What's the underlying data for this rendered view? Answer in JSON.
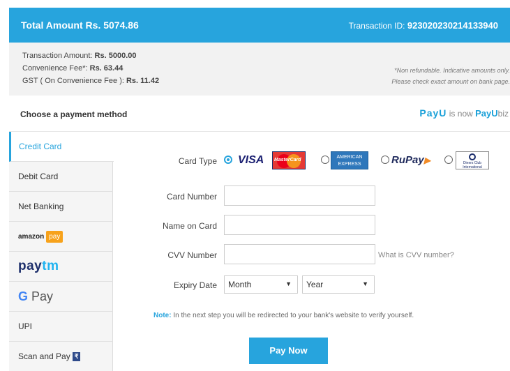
{
  "header": {
    "total_label": "Total Amount",
    "total_value": "Rs. 5074.86",
    "txn_label": "Transaction ID:",
    "txn_value": "923020230214133940"
  },
  "summary": {
    "txn_amount_label": "Transaction Amount:",
    "txn_amount": "Rs. 5000.00",
    "fee_label": "Convenience Fee*:",
    "fee": "Rs. 63.44",
    "gst_label": "GST ( On Convenience Fee ):",
    "gst": "Rs. 11.42",
    "note1": "*Non refundable. Indicative amounts only.",
    "note2": "Please check exact amount on bank page."
  },
  "choose_title": "Choose a payment method",
  "payu": {
    "brand": "PayU",
    "middle": "is now",
    "brand2": "PayU",
    "suffix": "biz"
  },
  "sidebar": {
    "credit_card": "Credit Card",
    "debit_card": "Debit Card",
    "net_banking": "Net Banking",
    "amazon": "amazon",
    "amazon_pay": "pay",
    "paytm_a": "pay",
    "paytm_b": "tm",
    "gpay_g": "G",
    "gpay_pay": "Pay",
    "upi": "UPI",
    "scan_pay": "Scan and Pay",
    "bharat": "₹"
  },
  "form": {
    "card_type_label": "Card Type",
    "visa": "VISA",
    "mastercard": "MasterCard",
    "amex_line1": "AMERICAN",
    "amex_line2": "EXPRESS",
    "rupay": "RuPay",
    "diners_line1": "Diners Club",
    "diners_line2": "International",
    "card_number_label": "Card Number",
    "card_number_value": "",
    "name_label": "Name on Card",
    "name_value": "",
    "cvv_label": "CVV Number",
    "cvv_value": "",
    "cvv_help": "What is CVV number?",
    "expiry_label": "Expiry Date",
    "month_value": "Month",
    "year_value": "Year",
    "note_label": "Note:",
    "note_text": "In the next step you will be redirected to your bank's website to verify yourself.",
    "pay_button": "Pay Now"
  },
  "colors": {
    "accent": "#27a4dd",
    "summary_bg": "#f2f2f2",
    "sidebar_bg": "#f5f5f5"
  },
  "icons": {
    "radio_selected": "radio-checked-icon",
    "chevron": "chevron-down-icon"
  }
}
